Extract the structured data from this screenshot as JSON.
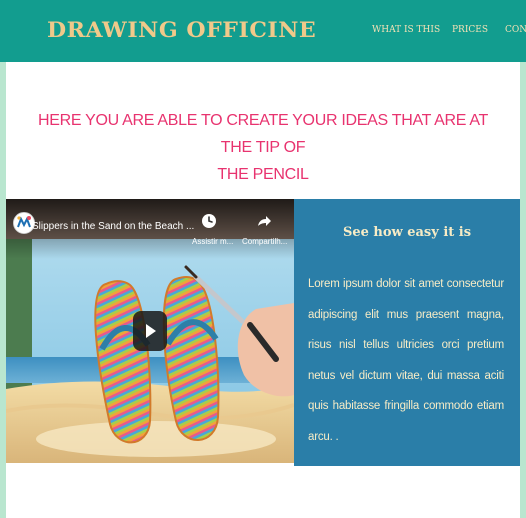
{
  "header": {
    "brand": "DRAWING OFFICINE",
    "nav": [
      "WHAT IS THIS",
      "PRICES",
      "CONT"
    ]
  },
  "hero": {
    "headline_line1": "HERE YOU ARE ABLE TO CREATE YOUR IDEAS THAT ARE AT THE TIP OF",
    "headline_line2": "THE PENCIL"
  },
  "video": {
    "title": "Slippers in the Sand on the Beach ...",
    "watch_later_label": "Assistir m...",
    "share_label": "Compartilh..."
  },
  "info": {
    "title": "See how easy it is",
    "body": "Lorem ipsum dolor sit amet consectetur adipiscing elit mus praesent magna, risus nisl tellus ultricies orci pretium netus vel dictum vitae, dui massa aciti quis habitasse fringilla commodo etiam arcu. ."
  },
  "colors": {
    "header_bg": "#129d8f",
    "brand": "#f0c98a",
    "headline": "#e8336f",
    "info_bg": "#2a7ea8"
  }
}
